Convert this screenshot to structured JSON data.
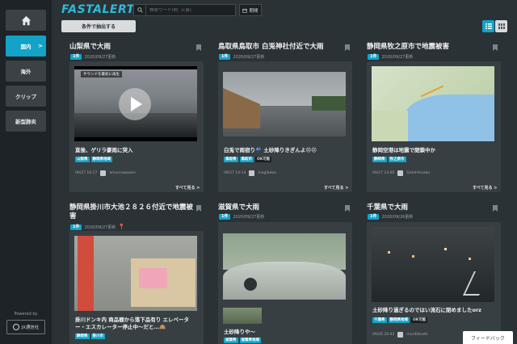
{
  "app": {
    "brand": "FASTALERT"
  },
  "sidebar": {
    "items": [
      {
        "label": "国内"
      },
      {
        "label": "海外"
      },
      {
        "label": "クリップ"
      },
      {
        "label": "新型肺炎"
      }
    ],
    "active_arrow": ">",
    "powered_by": "Powered by",
    "partner_logo": "JX通信社"
  },
  "header": {
    "search_placeholder": "検索ワード(例: 火事)",
    "period_label": "期間",
    "condition_button": "条件で抽出する"
  },
  "cards": [
    {
      "title": "山梨県で大雨",
      "count": "1件",
      "date": "2020/09/27更新",
      "post_text": "直後、ゲリラ豪雨に突入",
      "thumb_overlay": "サウンドを最初に再生",
      "tags": [
        "山梨県",
        "静岡県地域"
      ],
      "post_time": "09/27 16:17",
      "user": "amunsawaxen",
      "see_all": "すべて見る >"
    },
    {
      "title": "鳥取県鳥取市 白兎神社付近で大雨",
      "count": "1件",
      "date": "2020/09/27更新",
      "post_text": "白兎で雨宿り☔️ 土砂降りきぎんよ😣😣",
      "tags": [
        "鳥取県",
        "鳥取市",
        "OK可能"
      ],
      "post_time": "09/27 14:14",
      "user": "megibeba",
      "see_all": "すべて見る >"
    },
    {
      "title": "静岡県牧之原市で地震被害",
      "count": "1件",
      "date": "2020/09/27更新",
      "post_text": "静岡空港は地震で閉鎖中か",
      "tags": [
        "静岡県",
        "牧之原市"
      ],
      "post_time": "09/27 14:00",
      "user": "GetohHisaka",
      "see_all": "すべて見る >"
    },
    {
      "title": "静岡県掛川市大池２８２６付近で地震被害",
      "count": "1件",
      "date": "2020/09/27更新",
      "post_text": "掛川ドンキ内 商品棚から落下品有り エレベーター・エスカレーター停止中〜だと…🙈",
      "tags": [
        "静岡県",
        "掛川市"
      ]
    },
    {
      "title": "滋賀県で大雨",
      "count": "1件",
      "date": "2020/09/27更新",
      "post_text": "土砂降りや〜",
      "tags": [
        "滋賀県",
        "滋賀県地域"
      ]
    },
    {
      "title": "千葉県で大雨",
      "count": "1件",
      "date": "2020/09/26更新",
      "post_text": "土砂降り過ぎるのではい流石に閉めましたorz",
      "tags": [
        "千葉県",
        "静岡県地域",
        "OK可能"
      ],
      "post_time": "09/26 20:42",
      "user": "murl0death"
    }
  ],
  "feedback": "フィードバック"
}
